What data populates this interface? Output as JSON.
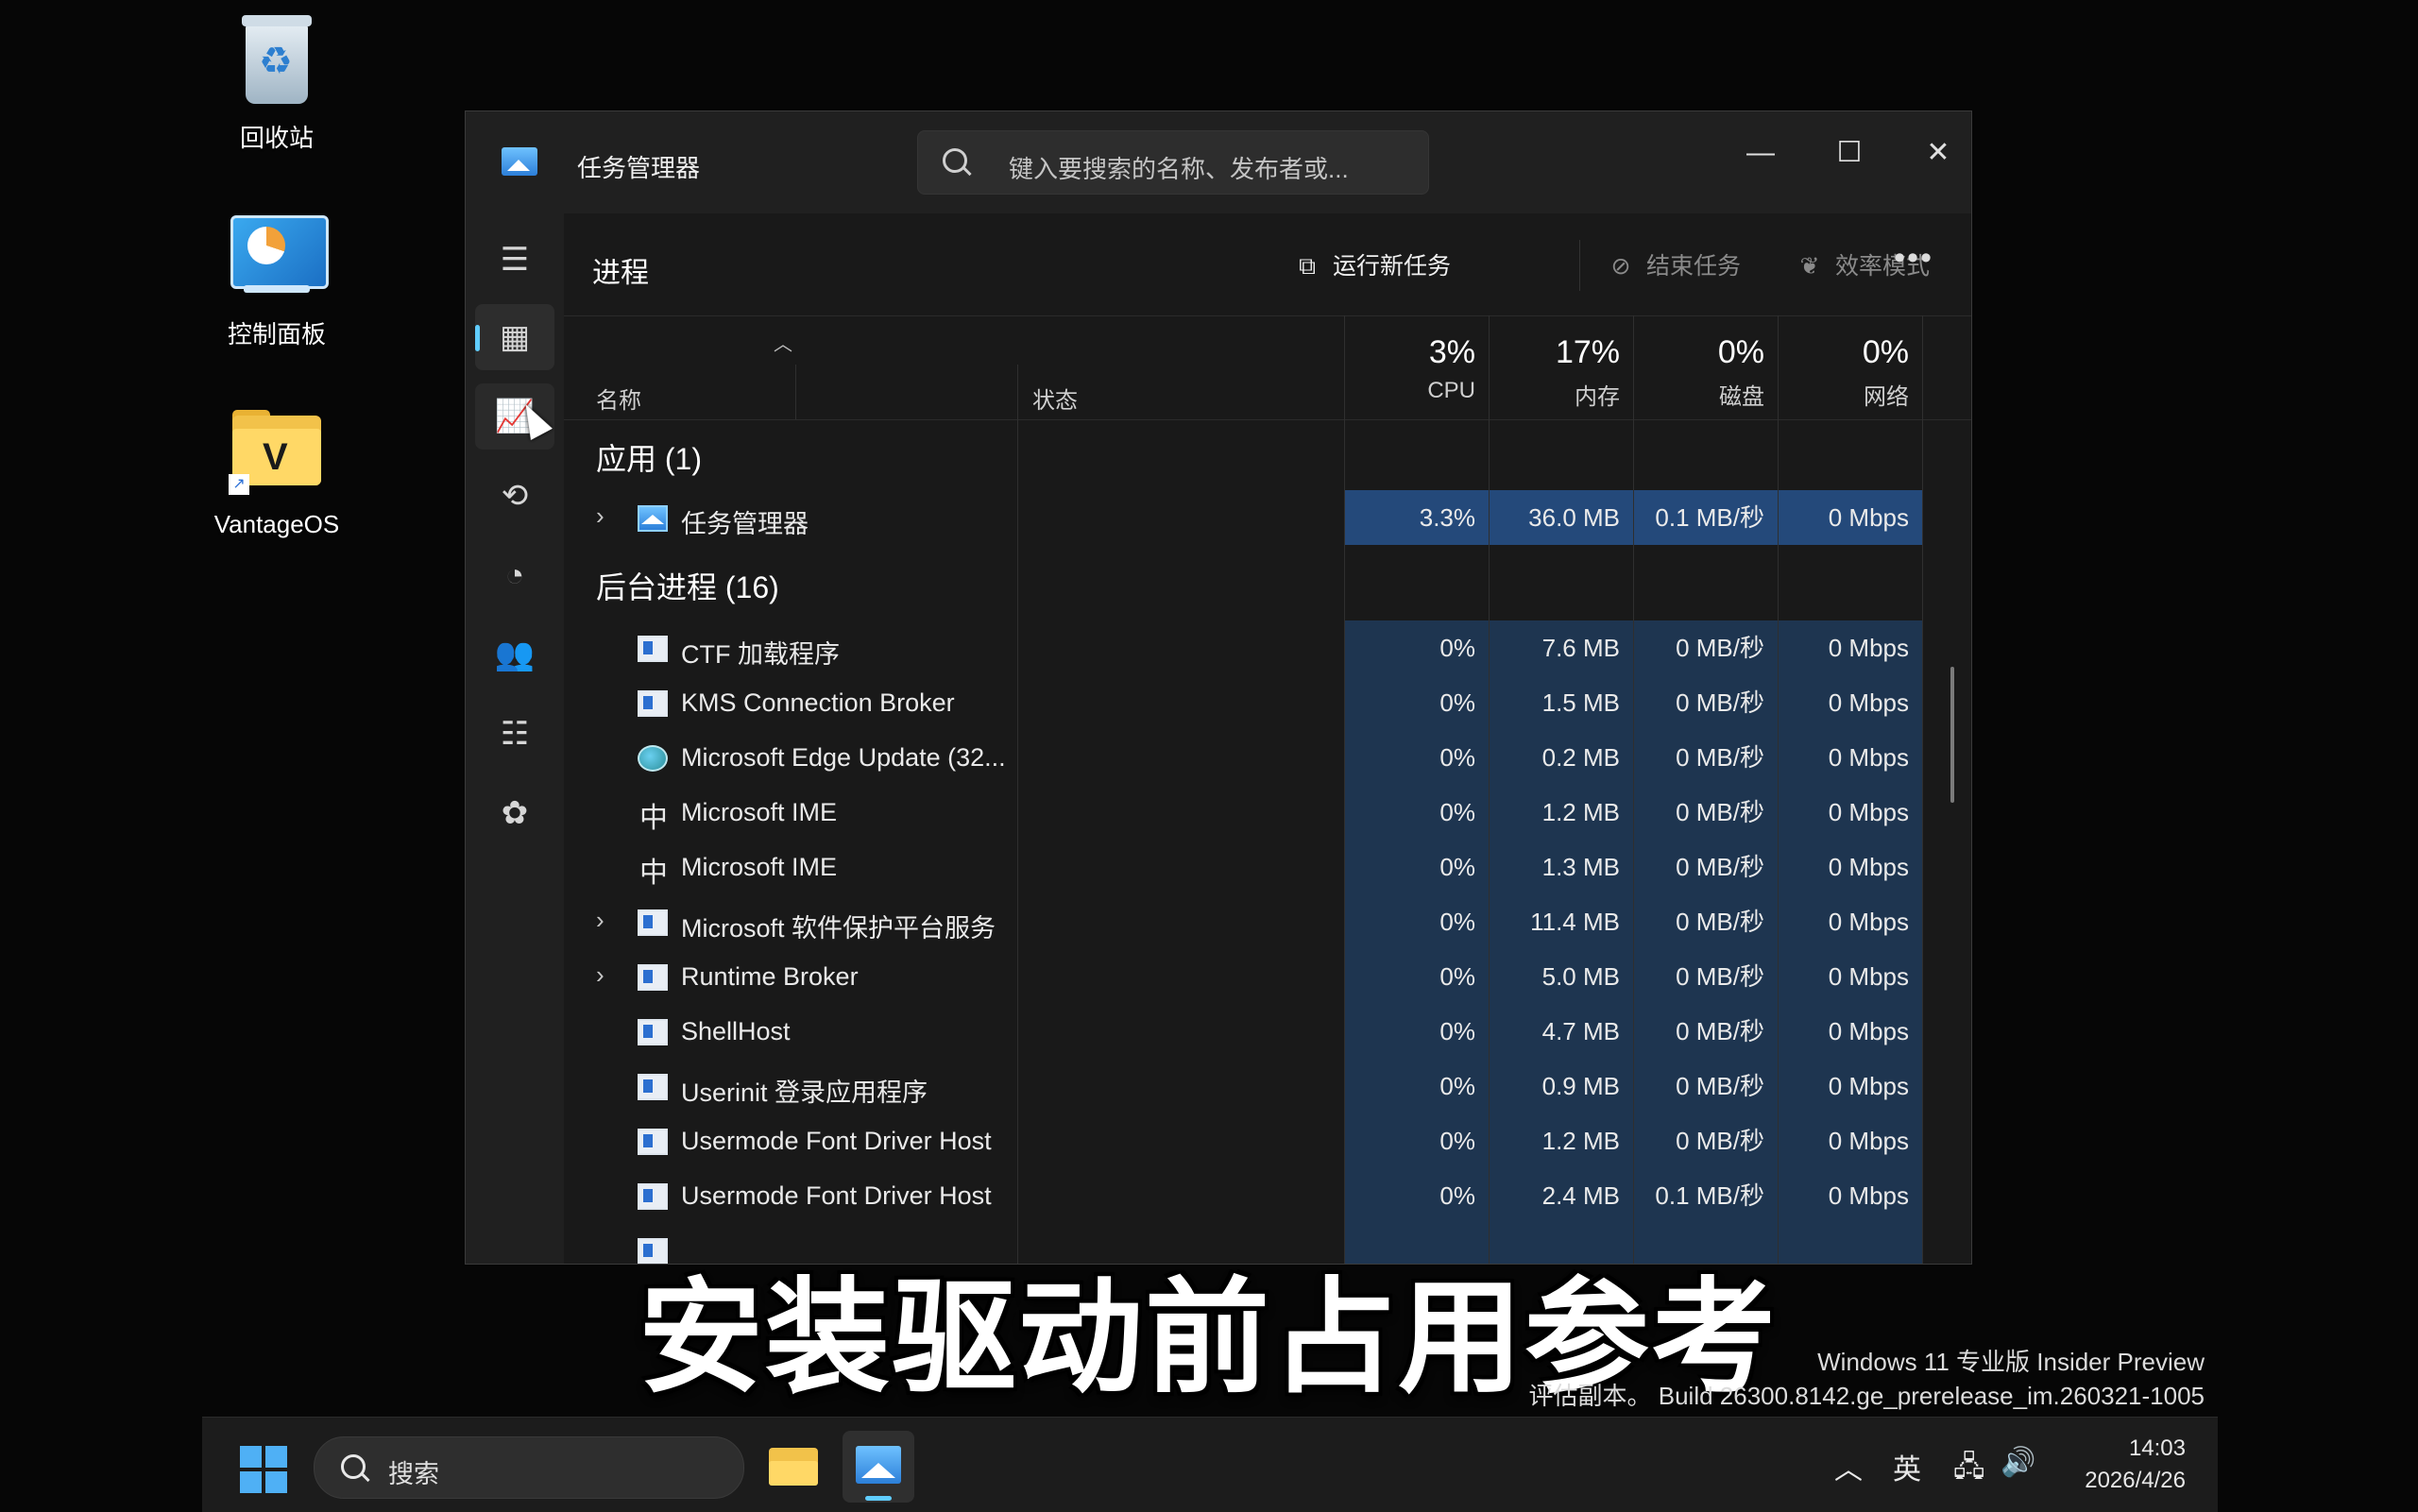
{
  "desktop": {
    "icons": [
      {
        "label": "回收站"
      },
      {
        "label": "控制面板"
      },
      {
        "label": "VantageOS"
      }
    ]
  },
  "window": {
    "title": "任务管理器",
    "search_placeholder": "键入要搜索的名称、发布者或...",
    "controls": {
      "minimize": "—",
      "maximize": "☐",
      "close": "✕"
    }
  },
  "commandbar": {
    "page_title": "进程",
    "run_new_task": "运行新任务",
    "end_task": "结束任务",
    "efficiency_mode": "效率模式",
    "more": "•••"
  },
  "columns": {
    "name": "名称",
    "status": "状态",
    "cpu": {
      "pct": "3%",
      "label": "CPU"
    },
    "memory": {
      "pct": "17%",
      "label": "内存"
    },
    "disk": {
      "pct": "0%",
      "label": "磁盘"
    },
    "network": {
      "pct": "0%",
      "label": "网络"
    }
  },
  "groups": {
    "apps": "应用 (1)",
    "background": "后台进程 (16)"
  },
  "apps": [
    {
      "name": "任务管理器",
      "cpu": "3.3%",
      "mem": "36.0 MB",
      "disk": "0.1 MB/秒",
      "net": "0 Mbps"
    }
  ],
  "background": [
    {
      "name": "CTF 加载程序",
      "cpu": "0%",
      "mem": "7.6 MB",
      "disk": "0 MB/秒",
      "net": "0 Mbps"
    },
    {
      "name": "KMS Connection Broker",
      "cpu": "0%",
      "mem": "1.5 MB",
      "disk": "0 MB/秒",
      "net": "0 Mbps"
    },
    {
      "name": "Microsoft Edge Update (32...",
      "cpu": "0%",
      "mem": "0.2 MB",
      "disk": "0 MB/秒",
      "net": "0 Mbps"
    },
    {
      "name": "Microsoft IME",
      "cpu": "0%",
      "mem": "1.2 MB",
      "disk": "0 MB/秒",
      "net": "0 Mbps"
    },
    {
      "name": "Microsoft IME",
      "cpu": "0%",
      "mem": "1.3 MB",
      "disk": "0 MB/秒",
      "net": "0 Mbps"
    },
    {
      "name": "Microsoft 软件保护平台服务",
      "cpu": "0%",
      "mem": "11.4 MB",
      "disk": "0 MB/秒",
      "net": "0 Mbps"
    },
    {
      "name": "Runtime Broker",
      "cpu": "0%",
      "mem": "5.0 MB",
      "disk": "0 MB/秒",
      "net": "0 Mbps"
    },
    {
      "name": "ShellHost",
      "cpu": "0%",
      "mem": "4.7 MB",
      "disk": "0 MB/秒",
      "net": "0 Mbps"
    },
    {
      "name": "Userinit 登录应用程序",
      "cpu": "0%",
      "mem": "0.9 MB",
      "disk": "0 MB/秒",
      "net": "0 Mbps"
    },
    {
      "name": "Usermode Font Driver Host",
      "cpu": "0%",
      "mem": "1.2 MB",
      "disk": "0 MB/秒",
      "net": "0 Mbps"
    },
    {
      "name": "Usermode Font Driver Host",
      "cpu": "0%",
      "mem": "2.4 MB",
      "disk": "0.1 MB/秒",
      "net": "0 Mbps"
    }
  ],
  "caption": "安装驱动前占用参考",
  "watermark": {
    "line1": "Windows 11 专业版 Insider Preview",
    "line2": "评估副本。 Build 26300.8142.ge_prerelease_im.260321-1005"
  },
  "taskbar": {
    "search": "搜索",
    "ime": "英",
    "time": "14:03",
    "date": "2026/4/26"
  }
}
